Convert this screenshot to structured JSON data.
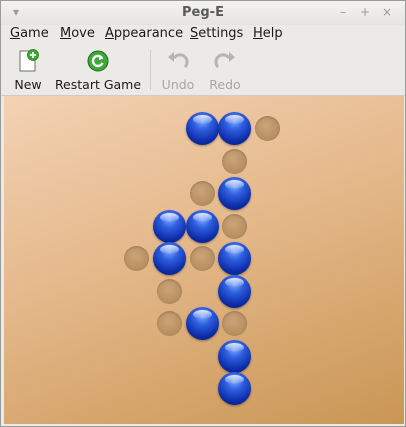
{
  "window": {
    "title": "Peg-E"
  },
  "menubar": {
    "items": [
      {
        "label": "Game",
        "mnemonic": "G",
        "rest": "ame"
      },
      {
        "label": "Move",
        "mnemonic": "M",
        "rest": "ove"
      },
      {
        "label": "Appearance",
        "mnemonic": "A",
        "rest": "ppearance"
      },
      {
        "label": "Settings",
        "mnemonic": "S",
        "rest": "ettings"
      },
      {
        "label": "Help",
        "mnemonic": "H",
        "rest": "elp"
      }
    ]
  },
  "toolbar": {
    "new_label": "New",
    "restart_label": "Restart Game",
    "undo_label": "Undo",
    "redo_label": "Redo"
  },
  "colors": {
    "peg": "#1a3fd0",
    "hole": "#b89163",
    "board": "#e4b88a"
  }
}
